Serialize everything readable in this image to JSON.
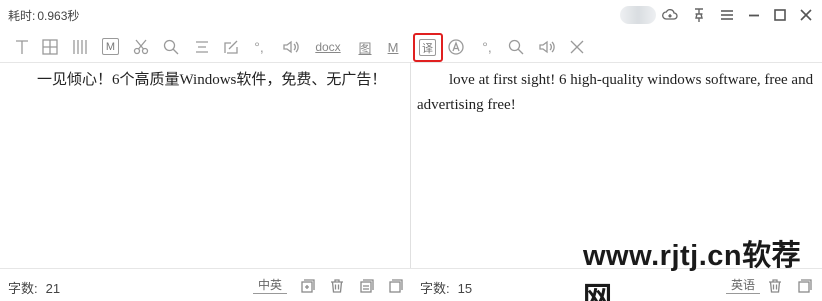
{
  "titlebar": {
    "elapsed_label": "耗时:",
    "elapsed_value": "0.963秒"
  },
  "toolbar": {
    "docx_label": "docx",
    "image_label": "图",
    "m_label": "M",
    "translate_label": "译",
    "highlight_color": "#e02020"
  },
  "left_pane": {
    "text": "一见倾心！6个高质量Windows软件，免费、无广告！"
  },
  "right_pane": {
    "text": "love at first sight! 6 high-quality windows software, free and advertising free!"
  },
  "statusbar": {
    "left_count_label": "字数:",
    "left_count_value": "21",
    "left_lang": "中英",
    "right_count_label": "字数:",
    "right_count_value": "15",
    "right_lang": "英语"
  },
  "watermark": "www.rjtj.cn软荐网"
}
